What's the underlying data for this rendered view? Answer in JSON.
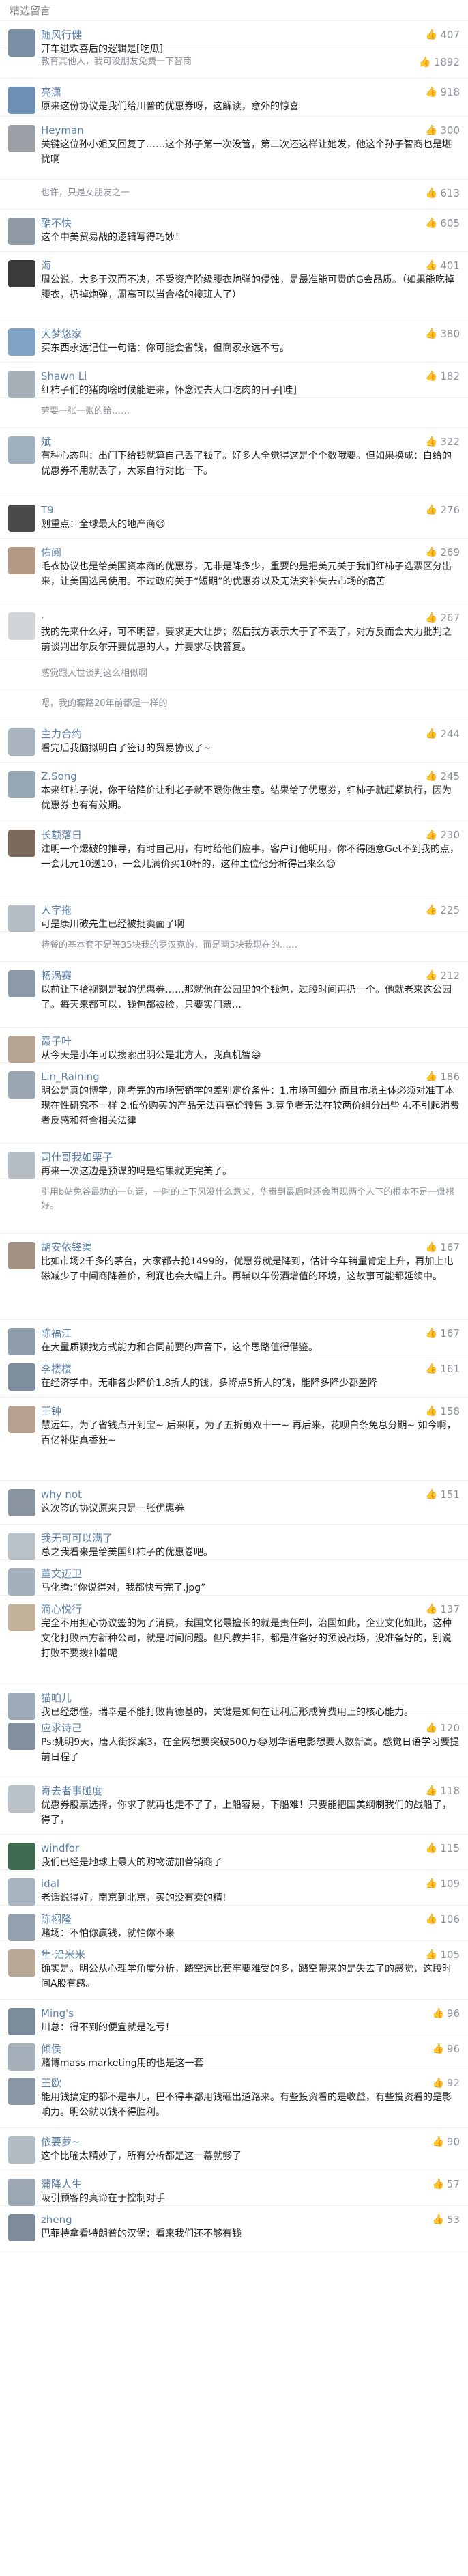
{
  "header": {
    "section_title": "精选留言"
  },
  "like_icon": "thumbs-up-icon",
  "comments": [
    {
      "name": "随风行健",
      "text": "开车进欢喜后的逻辑是[吃瓜]",
      "likes": "407",
      "avatar_color": "#7a8fa3"
    },
    {
      "name": "",
      "text": "教育其他人，我可没朋友免费一下智商",
      "likes": "1892",
      "avatar_color": "#b9a48f"
    },
    {
      "name": "亮潇",
      "text": "原来这份协议是我们给川普的优惠券呀，这解读，意外的惊喜",
      "likes": "918",
      "avatar_color": "#6d8fb5"
    },
    {
      "name": "Heyman",
      "text": "关键这位孙小姐又回复了……这个孙子第一次没管，第二次还这样让她发，他这个孙子智商也是堪忧啊",
      "likes": "300",
      "avatar_color": "#9aa0a6"
    },
    {
      "name": "",
      "text": "也许，只是女朋友之一",
      "likes": "613",
      "avatar_color": "#b0b6bd"
    },
    {
      "name": "酷不快",
      "text": "这个中美贸易战的逻辑写得巧妙！",
      "likes": "605",
      "avatar_color": "#8f9aa5"
    },
    {
      "name": "海",
      "text": "周公说，大多于汉而不决，不受资产阶级腰衣炮弹的侵蚀，是最准能可贵的G会品质。（如果能吃掉腰衣，扔掉炮弹，周高可以当合格的接班人了）",
      "likes": "401",
      "avatar_color": "#3b3b3b"
    },
    {
      "name": "大梦悠家",
      "text": "买东西永远记住一句话：你可能会省钱，但商家永远不亏。",
      "likes": "380",
      "avatar_color": "#7fa3c4"
    },
    {
      "name": "Shawn Li",
      "text": "红柿子们的猪肉啥时候能进来，怀念过去大口吃肉的日子[哇]",
      "likes": "182",
      "avatar_color": "#a7b0b8"
    },
    {
      "name": "",
      "text": "劳要一张一张的给……",
      "likes": "",
      "avatar_color": "#c5cbd1"
    },
    {
      "name": "斌",
      "text": "有种心态叫：出门下给钱就算自己丢了钱了。好多人全觉得这是个个数哦要。但如果换成：白给的优惠券不用就丢了，大家自行对比一下。",
      "likes": "322",
      "avatar_color": "#9fb0c0"
    },
    {
      "name": "T9",
      "text": "划重点：全球最大的地产商😄",
      "likes": "276",
      "avatar_color": "#4a4a4a"
    },
    {
      "name": "佑阅",
      "text": "毛衣协议也是给美国资本商的优惠券，无非是降多少，重要的是把美元关于我们红柿子选票区分出来，让美国选民使用。不过政府关于“短期”的优惠券以及无法究补失去市场的痛苦",
      "likes": "269",
      "avatar_color": "#b39a86"
    },
    {
      "name": "·",
      "text": "我的先来什么好，可不明智，要求更大让步；然后我方表示大于了不丢了，对方反而会大力批判之前谈判出尔反尔开要优惠的人，并要求尽快答复。",
      "likes": "267",
      "avatar_color": "#d1d5da"
    },
    {
      "name": "",
      "text": "感觉跟人世谈判这么相似啊",
      "likes": "",
      "avatar_color": "#c5cbd1"
    },
    {
      "name": "",
      "text": "嗯，我的套路20年前都是一样的",
      "likes": "",
      "avatar_color": "#c5cbd1"
    },
    {
      "name": "主力合约",
      "text": "看完后我脑拟明白了签订的贸易协议了~",
      "likes": "244",
      "avatar_color": "#a9b4bf"
    },
    {
      "name": "Z.Song",
      "text": "本来红柿子说，你干给降价让利老子就不跟你做生意。结果给了优惠券，红柿子就赶紧执行，因为优惠券也有有效期。",
      "likes": "245",
      "avatar_color": "#97a6b5"
    },
    {
      "name": "长额落日",
      "text": "注明一个爆破的推导，有时自己用，有时给他们应事，客户订他明用，你不得随意Get不到我的点，一会儿元10送10，一会儿满价买10杯的，这种主位他分析得出来么😊",
      "likes": "230",
      "avatar_color": "#7d6a5a"
    },
    {
      "name": "人字拖",
      "text": "可是康川破先生已经被批卖面了啊",
      "likes": "225",
      "avatar_color": "#b4bcc4"
    },
    {
      "name": "",
      "text": "特餐的基本套不是等35块我的罗汉克的，而是两5块我现在的……",
      "likes": "",
      "avatar_color": "#c5cbd1"
    },
    {
      "name": "畅涡赛",
      "text": "以前让下拾视刻是我的优惠券……那就他在公园里的个钱包，过段时间再扔一个。他就老来这公园了。每天来都可以，钱包都被捡，只要实门票…",
      "likes": "212",
      "avatar_color": "#8c99a6"
    },
    {
      "name": "霞子叶",
      "text": "从今天是小年可以搜索出明公是北方人，我真机智😄",
      "likes": "",
      "avatar_color": "#b8a493"
    },
    {
      "name": "Lin_Raining",
      "text": "明公是真的博学，刚考完的市场营销学的差别定价条件：1.市场可细分 而且市场主体必须对准丁本现在性研究不一样 2.低价购买的产品无法再高价转售 3.竞争者无法在较两价组分出些 4.不引起消费者反感和符合相关法律",
      "likes": "186",
      "avatar_color": "#9aa6b2"
    },
    {
      "name": "司仕哥我如栗子",
      "text": "再来一次这边是预谋的吗是结果就更完美了。",
      "likes": "",
      "avatar_color": "#b5bdc5"
    },
    {
      "name": "",
      "text": "引用b站免谷最劝的一句话，一时的上下风没什么意义，华贵到最后时还会再现两个人下的根本不是一盘棋好。",
      "likes": "",
      "avatar_color": "#c5cbd1"
    },
    {
      "name": "胡安依锋渠",
      "text": "比如市场2千多的茅台，大家都去抢1499的，优惠券就是降到，估计今年销量肯定上升，再加上电磁减少了中间商降差价，利润也会大幅上升。再辅以年份酒增值的环境，这故事可能都延续中。",
      "likes": "167",
      "avatar_color": "#a39283"
    },
    {
      "name": "陈福江",
      "text": "在大量质颖找方式能力和合同前要的声音下，这个思路值得借鉴。",
      "likes": "167",
      "avatar_color": "#8f9ca9"
    },
    {
      "name": "李楼楼",
      "text": "在经济学中，无非各少降价1.8折人的钱，多降点5折人的钱，能降多降少都盈降",
      "likes": "161",
      "avatar_color": "#7d8e9f"
    },
    {
      "name": "王钟",
      "text": "慧远年，为了省钱点开到宝~ 后来啊，为了五折剪双十一~ 再后来，花呗白条免息分期~ 如今啊，百亿补贴真香狂~",
      "likes": "158",
      "avatar_color": "#b7a18e"
    },
    {
      "name": "why not",
      "text": "这次签的协议原来只是一张优惠券",
      "likes": "151",
      "avatar_color": "#8994a0"
    },
    {
      "name": "我无可可以满了",
      "text": "总之我看来是给美国红柿子的优惠卷吧。",
      "likes": "",
      "avatar_color": "#b8c0c8"
    },
    {
      "name": "董文迈卫",
      "text": "马化腾:“你说得对，我都快亏完了.jpg”",
      "likes": "",
      "avatar_color": "#a4b1bd"
    },
    {
      "name": "滴心悦行",
      "text": "完全不用担心协议签的为了消费，我国文化最擅长的就是责任制，治国如此，企业文化如此，这种文化打败西方新种公司，就是时间问题。但凡教并非，都是准备好的预设战场，没准备好的，别说打败不要拨神着呢",
      "likes": "137",
      "avatar_color": "#c4b19c"
    },
    {
      "name": "猫咱儿",
      "text": "我已经想懂，瑞幸是不能打败肯德基的，关键是如何在让利后形成算费用上的核心能力。",
      "likes": "",
      "avatar_color": "#9dabb8"
    },
    {
      "name": "应求诗己",
      "text": "Ps:姚明9天，唐人街探案3，在全网想要突破500万😂划华语电影想要人数新高。感觉日语学习要提前日程了",
      "likes": "120",
      "avatar_color": "#8290a0"
    },
    {
      "name": "寄去者事碰度",
      "text": "优惠券股票选择，你求了就再也走不了了，上船容易，下船难！只要能把国美纲制我们的战船了，得了，",
      "likes": "118",
      "avatar_color": "#b9c1c9"
    },
    {
      "name": "windfor",
      "text": "我们已经是地球上最大的购物游加营销商了",
      "likes": "115",
      "avatar_color": "#3e6b4f"
    },
    {
      "name": "idal",
      "text": "老话说得好，南京到北京，买的没有卖的精!",
      "likes": "109",
      "avatar_color": "#a7b3bf"
    },
    {
      "name": "陈栩隆",
      "text": "赌场：不怕你赢钱，就怕你不来",
      "likes": "106",
      "avatar_color": "#94a2b0"
    },
    {
      "name": "隼·沿米米",
      "text": "确实是。明公从心理学角度分析，踏空远比套牢要难受的多，踏空带来的是失去了的感觉，这段时间A股有感。",
      "likes": "105",
      "avatar_color": "#b8a896"
    },
    {
      "name": "Ming's",
      "text": "川总：得不到的便宜就是吃亏！",
      "likes": "96",
      "avatar_color": "#7c8c9c"
    },
    {
      "name": "倾侯",
      "text": "赌博mass marketing用的也是这一套",
      "likes": "96",
      "avatar_color": "#a5b0ba"
    },
    {
      "name": "王欧",
      "text": "能用钱搞定的都不是事儿，巴不得事都用钱砸出道路来。有些投资看的是收益，有些投资看的是影响力。明公就以钱不得胜利。",
      "likes": "92",
      "avatar_color": "#8a98a6"
    },
    {
      "name": "依要萝~",
      "text": "这个比喻太精妙了，所有分析都是这一幕就够了",
      "likes": "90",
      "avatar_color": "#b3bcc5"
    },
    {
      "name": "蒲降人生",
      "text": "吸引顾客的真谛在于控制对手",
      "likes": "57",
      "avatar_color": "#9ba7b3"
    },
    {
      "name": "zheng",
      "text": "巴菲特拿看特朗普的汉堡：看来我们还不够有钱",
      "likes": "53",
      "avatar_color": "#7e8b98"
    }
  ]
}
